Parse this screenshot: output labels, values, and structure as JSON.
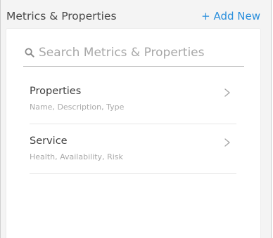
{
  "header": {
    "title": "Metrics & Properties",
    "add_new_label": "+ Add New"
  },
  "search": {
    "placeholder": "Search Metrics & Properties",
    "value": ""
  },
  "items": [
    {
      "title": "Properties",
      "subtitle": "Name, Description, Type",
      "icon": "chevron-right-icon"
    },
    {
      "title": "Service",
      "subtitle": "Health, Availability, Risk",
      "icon": "chevron-right-icon"
    }
  ],
  "colors": {
    "accent": "#2a8fdc",
    "panel_bg": "#f4f4f4",
    "card_bg": "#ffffff"
  }
}
